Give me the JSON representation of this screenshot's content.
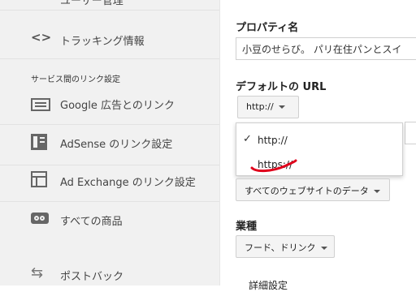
{
  "sidebar": {
    "top_item_label": "ユーザー管理",
    "tracking_label": "トラッキング情報",
    "section_title": "サービス間のリンク設定",
    "items": [
      {
        "label": "Google 広告とのリンク",
        "icon": "ads-icon"
      },
      {
        "label": "AdSense のリンク設定",
        "icon": "adsense-icon"
      },
      {
        "label": "Ad Exchange のリンク設定",
        "icon": "ad-exchange-icon"
      },
      {
        "label": "すべての商品",
        "icon": "link-icon"
      },
      {
        "label": "ポストバック",
        "icon": "postback-icon"
      }
    ]
  },
  "main": {
    "property_name_label": "プロパティ名",
    "property_name_value": "小豆のせらび。 パリ在住パンとスイ",
    "default_url_label": "デフォルトの URL",
    "protocol_selected": "http://",
    "protocol_options": [
      {
        "label": "http://",
        "checked": true
      },
      {
        "label": "https://",
        "checked": false
      }
    ],
    "view_select": "すべてのウェブサイトのデータ",
    "industry_label": "業種",
    "industry_value": "フード、ドリンク",
    "bottom_cut_label": "詳細設定"
  },
  "colors": {
    "annotation_underline": "#e0001b",
    "sidebar_bg": "#f1f1f1"
  }
}
